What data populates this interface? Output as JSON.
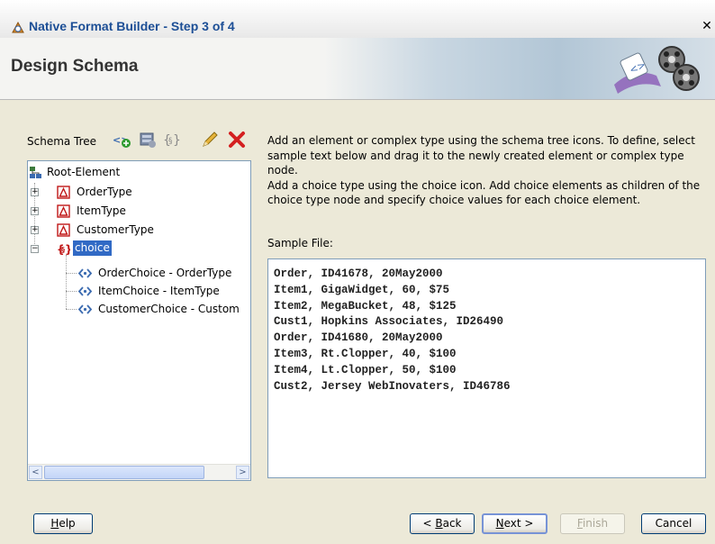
{
  "window": {
    "title": "Native Format Builder - Step 3 of 4",
    "close_glyph": "✕"
  },
  "header": {
    "title": "Design Schema"
  },
  "schema_tree": {
    "label": "Schema Tree",
    "toolbar_icons": [
      "add-element-icon",
      "add-complex-type-icon",
      "add-choice-icon",
      "edit-pencil-icon",
      "delete-icon"
    ],
    "nodes": [
      {
        "label": "Root-Element",
        "icon": "schema-root-icon"
      },
      {
        "label": "OrderType",
        "icon": "complex-type-icon",
        "expander": "+"
      },
      {
        "label": "ItemType",
        "icon": "complex-type-icon",
        "expander": "+"
      },
      {
        "label": "CustomerType",
        "icon": "complex-type-icon",
        "expander": "+"
      },
      {
        "label": "choice",
        "icon": "choice-icon",
        "expander": "−",
        "selected": true
      },
      {
        "label": "OrderChoice - OrderType",
        "icon": "element-icon"
      },
      {
        "label": "ItemChoice - ItemType",
        "icon": "element-icon"
      },
      {
        "label": "CustomerChoice - Custom",
        "icon": "element-icon"
      }
    ],
    "scroll_left": "<",
    "scroll_right": ">"
  },
  "instructions": {
    "p1": "Add an element or complex type using the schema tree icons. To define, select sample text below and drag it to the newly created element or complex type node.",
    "p2": "Add a choice type using the choice icon. Add choice elements as children of the choice type node and specify choice values for each choice element."
  },
  "sample": {
    "label": "Sample File:",
    "lines": [
      "Order, ID41678, 20May2000",
      "Item1, GigaWidget, 60, $75",
      "Item2, MegaBucket, 48, $125",
      "Cust1, Hopkins Associates, ID26490",
      "Order, ID41680, 20May2000",
      "Item3, Rt.Clopper, 40, $100",
      "Item4, Lt.Clopper, 50, $100",
      "Cust2, Jersey WebInovaters, ID46786"
    ]
  },
  "buttons": {
    "help": {
      "mnemonic": "H",
      "rest": "elp"
    },
    "back": {
      "pre": "< ",
      "mnemonic": "B",
      "rest": "ack"
    },
    "next": {
      "mnemonic": "N",
      "rest": "ext >"
    },
    "finish": {
      "mnemonic": "F",
      "rest": "inish"
    },
    "cancel": "Cancel"
  },
  "colors": {
    "selection": "#316ac5",
    "title_text": "#1d4f96",
    "delete_red": "#d42020"
  }
}
